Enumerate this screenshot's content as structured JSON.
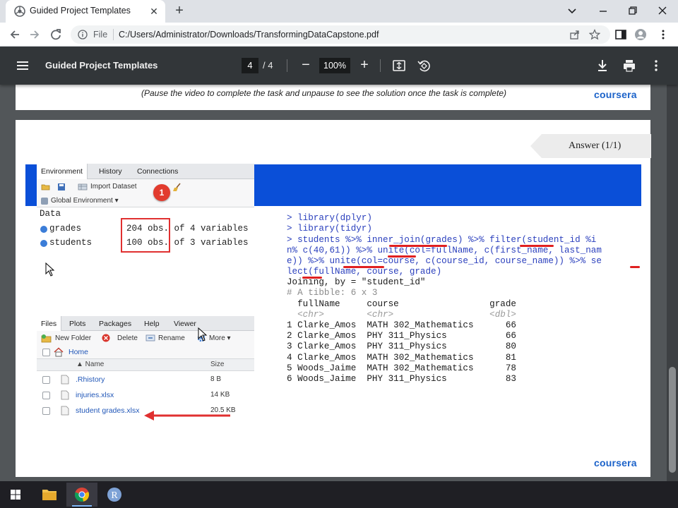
{
  "browser": {
    "tab_title": "Guided Project Templates",
    "new_tab_symbol": "+",
    "url_scheme": "File",
    "url": "C:/Users/Administrator/Downloads/TransformingDataCapstone.pdf"
  },
  "pdf_toolbar": {
    "title": "Guided Project Templates",
    "current_page": "4",
    "page_total": "/ 4",
    "zoom": "100%"
  },
  "prev_page": {
    "caption": "(Pause the video to complete the task and unpause to see the solution once the task is complete)",
    "logo": "coursera"
  },
  "current_page": {
    "answer_label": "Answer (1/1)",
    "logo": "coursera"
  },
  "environment": {
    "tabs": [
      "Environment",
      "History",
      "Connections"
    ],
    "import_label": "Import Dataset",
    "scope_label": "Global Environment ▾",
    "data_header": "Data",
    "rows": [
      {
        "name": "grades",
        "value": "204 obs. of 4 variables"
      },
      {
        "name": "students",
        "value": "100 obs. of 3 variables"
      }
    ],
    "badge": "1"
  },
  "files": {
    "tabs": [
      "Files",
      "Plots",
      "Packages",
      "Help",
      "Viewer"
    ],
    "new_folder": "New Folder",
    "delete": "Delete",
    "rename": "Rename",
    "more": "More ▾",
    "path": "Home",
    "col_name": "▲ Name",
    "col_size": "Size",
    "rows": [
      {
        "name": ".Rhistory",
        "size": "8 B"
      },
      {
        "name": "injuries.xlsx",
        "size": "14 KB"
      },
      {
        "name": "student grades.xlsx",
        "size": "20.5 KB"
      }
    ]
  },
  "console": {
    "lines": [
      "> library(dplyr)",
      "> library(tidyr)",
      "> students %>% inner_join(grades) %>% filter(student_id %i",
      "n% c(40,61)) %>% unite(col=fullName, c(first_name, last_nam",
      "e)) %>% unite(col=course, c(course_id, course_name)) %>% se",
      "lect(fullName, course, grade)",
      "Joining, by = \"student_id\"",
      "# A tibble: 6 x 3",
      "  fullName     course                 grade",
      "  <chr>        <chr>                  <dbl>",
      "1 Clarke_Amos  MATH 302_Mathematics      66",
      "2 Clarke_Amos  PHY 311_Physics           66",
      "3 Clarke_Amos  PHY 311_Physics           80",
      "4 Clarke_Amos  MATH 302_Mathematics      81",
      "5 Woods_Jaime  MATH 302_Mathematics      78",
      "6 Woods_Jaime  PHY 311_Physics           83"
    ]
  },
  "colors": {
    "accent_blue": "#0a4fd8",
    "annotation_red": "#e03030",
    "coursera_blue": "#1b62c9"
  },
  "icons": [
    "chrome-page-icon",
    "close-icon",
    "back-icon",
    "forward-icon",
    "reload-icon",
    "info-icon",
    "share-icon",
    "star-icon",
    "sidebar-icon",
    "profile-icon",
    "kebab-icon",
    "hamburger-icon",
    "fit-page-icon",
    "rotate-icon",
    "download-icon",
    "print-icon",
    "windows-start-icon",
    "file-explorer-icon",
    "chrome-icon",
    "r-icon"
  ]
}
